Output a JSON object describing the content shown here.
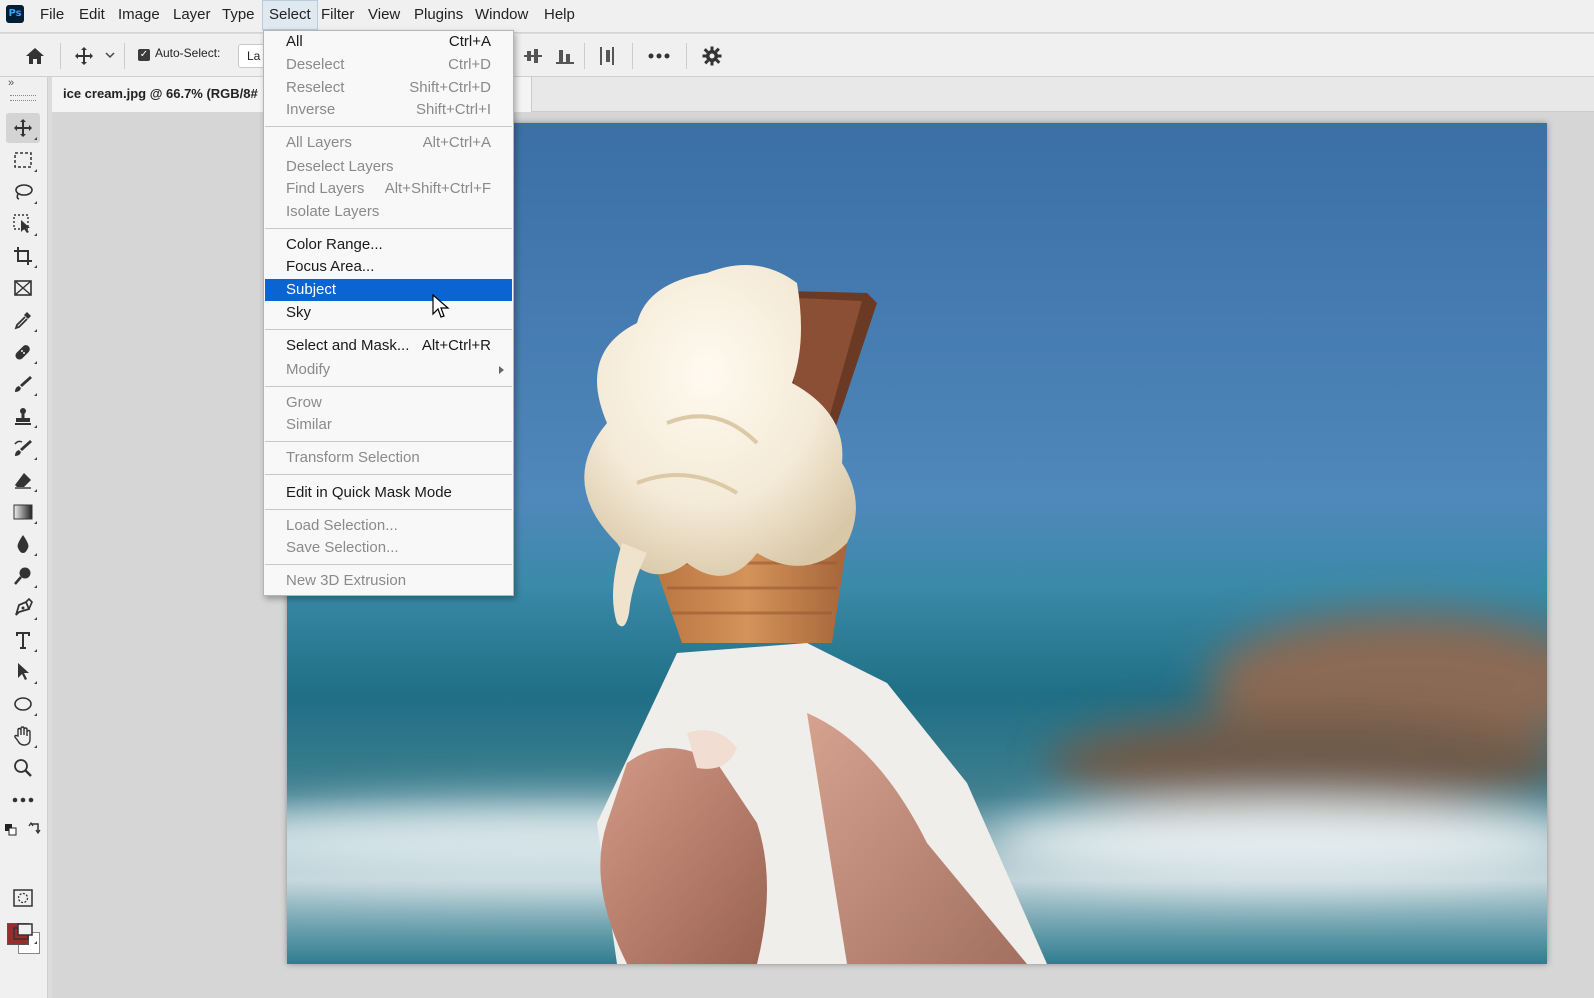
{
  "app": {
    "logo_text": "Ps"
  },
  "menubar": {
    "items": [
      {
        "label": "File"
      },
      {
        "label": "Edit"
      },
      {
        "label": "Image"
      },
      {
        "label": "Layer"
      },
      {
        "label": "Type"
      },
      {
        "label": "Select"
      },
      {
        "label": "Filter"
      },
      {
        "label": "View"
      },
      {
        "label": "Plugins"
      },
      {
        "label": "Window"
      },
      {
        "label": "Help"
      }
    ],
    "active": "Select"
  },
  "options_bar": {
    "auto_select_label": "Auto-Select:",
    "auto_select_checked": true,
    "layer_dropdown_value": "La",
    "icons": [
      "home-icon",
      "move-tool-icon",
      "chevron-down-icon",
      "align-vertical-centers-icon",
      "align-bottom-edges-icon",
      "distribute-icon",
      "more-options-icon",
      "settings-gear-icon"
    ]
  },
  "document": {
    "tab_title": "ice cream.jpg @ 66.7% (RGB/8#"
  },
  "select_menu": {
    "items": [
      {
        "label": "All",
        "shortcut": "Ctrl+A",
        "enabled": true
      },
      {
        "label": "Deselect",
        "shortcut": "Ctrl+D",
        "enabled": false
      },
      {
        "label": "Reselect",
        "shortcut": "Shift+Ctrl+D",
        "enabled": false
      },
      {
        "label": "Inverse",
        "shortcut": "Shift+Ctrl+I",
        "enabled": false
      },
      {
        "label": "All Layers",
        "shortcut": "Alt+Ctrl+A",
        "enabled": false
      },
      {
        "label": "Deselect Layers",
        "shortcut": "",
        "enabled": false
      },
      {
        "label": "Find Layers",
        "shortcut": "Alt+Shift+Ctrl+F",
        "enabled": false
      },
      {
        "label": "Isolate Layers",
        "shortcut": "",
        "enabled": false
      },
      {
        "label": "Color Range...",
        "shortcut": "",
        "enabled": true
      },
      {
        "label": "Focus Area...",
        "shortcut": "",
        "enabled": true
      },
      {
        "label": "Subject",
        "shortcut": "",
        "enabled": true,
        "highlighted": true
      },
      {
        "label": "Sky",
        "shortcut": "",
        "enabled": true
      },
      {
        "label": "Select and Mask...",
        "shortcut": "Alt+Ctrl+R",
        "enabled": true
      },
      {
        "label": "Modify",
        "shortcut": "",
        "enabled": false,
        "submenu": true
      },
      {
        "label": "Grow",
        "shortcut": "",
        "enabled": false
      },
      {
        "label": "Similar",
        "shortcut": "",
        "enabled": false
      },
      {
        "label": "Transform Selection",
        "shortcut": "",
        "enabled": false
      },
      {
        "label": "Edit in Quick Mask Mode",
        "shortcut": "",
        "enabled": true
      },
      {
        "label": "Load Selection...",
        "shortcut": "",
        "enabled": false
      },
      {
        "label": "Save Selection...",
        "shortcut": "",
        "enabled": false
      },
      {
        "label": "New 3D Extrusion",
        "shortcut": "",
        "enabled": false
      }
    ]
  },
  "toolbox": {
    "collapse_glyph": "»",
    "tools": [
      "move-tool-icon",
      "marquee-tool-icon",
      "lasso-tool-icon",
      "object-selection-tool-icon",
      "crop-tool-icon",
      "frame-tool-icon",
      "eyedropper-tool-icon",
      "healing-brush-tool-icon",
      "brush-tool-icon",
      "clone-stamp-tool-icon",
      "history-brush-tool-icon",
      "eraser-tool-icon",
      "gradient-tool-icon",
      "blur-tool-icon",
      "dodge-tool-icon",
      "pen-tool-icon",
      "type-tool-icon",
      "path-selection-tool-icon",
      "ellipse-tool-icon",
      "hand-tool-icon",
      "zoom-tool-icon",
      "more-tools-icon"
    ],
    "selected_tool": "move-tool-icon",
    "foreground_color": "#9b2c2c",
    "background_color": "#ffffff"
  },
  "colors": {
    "menu_highlight": "#0a64d2",
    "ps_brand": "#001e36",
    "ps_brand_accent": "#31a8ff"
  }
}
